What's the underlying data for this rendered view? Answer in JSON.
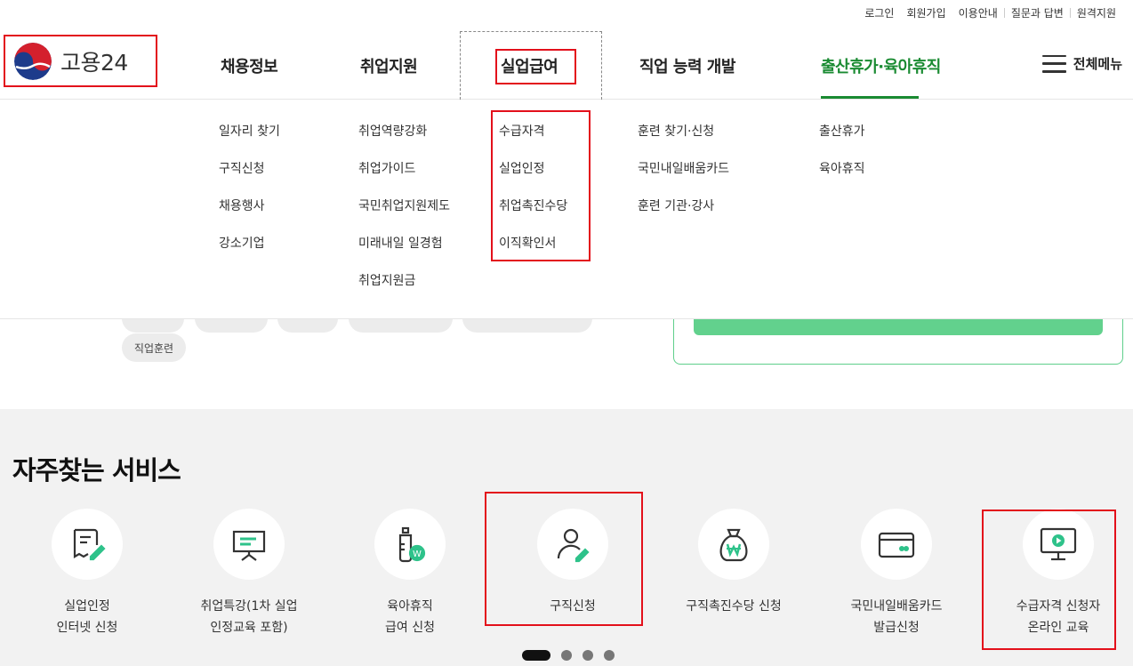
{
  "utility_links": [
    "로그인",
    "회원가입",
    "이용안내",
    "질문과 답변",
    "원격지원"
  ],
  "logo": {
    "text": "고용24",
    "mark_icon": "taegeuk-icon"
  },
  "gnb": {
    "items": [
      "채용정보",
      "취업지원",
      "실업급여",
      "직업 능력 개발",
      "출산휴가·육아휴직"
    ],
    "all_menu_label": "전체메뉴",
    "active_item": "실업급여",
    "highlight_color": "#1a8b32"
  },
  "dropdown": {
    "columns": [
      [
        "일자리 찾기",
        "구직신청",
        "채용행사",
        "강소기업"
      ],
      [
        "취업역량강화",
        "취업가이드",
        "국민취업지원제도",
        "미래내일 일경험",
        "취업지원금"
      ],
      [
        "수급자격",
        "실업인정",
        "취업촉진수당",
        "이직확인서"
      ],
      [
        "훈련 찾기·신청",
        "국민내일배움카드",
        "훈련 기관·강사"
      ],
      [
        "출산휴가",
        "육아휴직"
      ]
    ]
  },
  "background_tags": [
    "직업훈련"
  ],
  "services": {
    "title": "자주찾는 서비스",
    "items": [
      {
        "label": "실업인정\n인터넷 신청",
        "icon": "document-pen-icon"
      },
      {
        "label": "취업특강(1차 실업\n인정교육 포함)",
        "icon": "presentation-board-icon"
      },
      {
        "label": "육아휴직\n급여 신청",
        "icon": "baby-bottle-won-icon"
      },
      {
        "label": "구직신청",
        "icon": "person-pen-icon"
      },
      {
        "label": "구직촉진수당 신청",
        "icon": "money-bag-won-icon"
      },
      {
        "label": "국민내일배움카드\n발급신청",
        "icon": "card-icon"
      },
      {
        "label": "수급자격 신청자\n온라인 교육",
        "icon": "monitor-play-icon"
      }
    ],
    "pager": {
      "pages": 4,
      "current": 1
    },
    "accent_color": "#2ec28a"
  },
  "annotation_color": "#e3101b"
}
